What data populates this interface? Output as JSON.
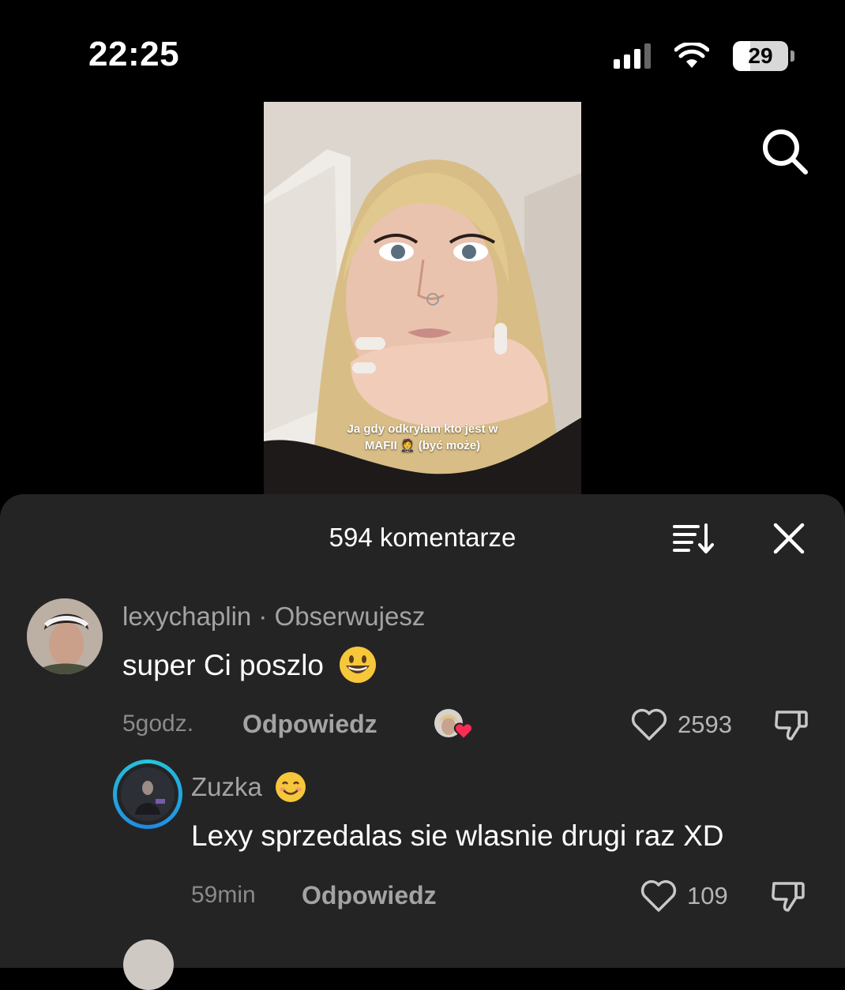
{
  "status_bar": {
    "time": "22:25",
    "battery_level": "29"
  },
  "video": {
    "caption_line1": "Ja gdy odkryłam kto jest w",
    "caption_line2": "MAFII 🤵 (być może)"
  },
  "comments_header": {
    "title": "594 komentarze"
  },
  "comments": [
    {
      "username": "lexychaplin",
      "meta": " · Obserwujesz",
      "text": "super Ci poszlo",
      "emoji": "grinning-face",
      "time": "5godz.",
      "reply_label": "Odpowiedz",
      "likes": "2593"
    }
  ],
  "replies": [
    {
      "username": "Zuzka",
      "emoji": "smiling-face",
      "text": "Lexy sprzedalas sie wlasnie drugi raz XD",
      "time": "59min",
      "reply_label": "Odpowiedz",
      "likes": "109"
    }
  ],
  "colors": {
    "sheet_bg": "#242424",
    "like_heart_accent": "#fe2c55",
    "story_ring": "#26c6da"
  }
}
